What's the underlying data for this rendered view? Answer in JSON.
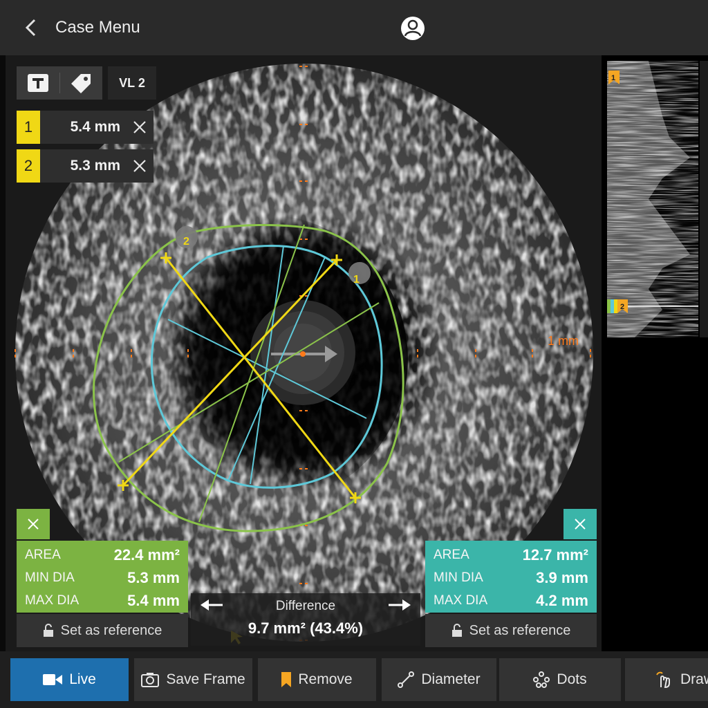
{
  "header": {
    "back_icon": "chevron-left-icon",
    "title": "Case Menu",
    "user_icon": "user-circle-icon"
  },
  "tools": {
    "text_tool_icon": "text-t-icon",
    "tag_tool_icon": "tag-icon",
    "vessel_label": "VL 2"
  },
  "measurements": [
    {
      "index": "1",
      "value": "5.4 mm"
    },
    {
      "index": "2",
      "value": "5.3 mm"
    }
  ],
  "scale_label": "1 mm",
  "frame_markers": [
    "1",
    "2"
  ],
  "left_panel": {
    "color": "#7cb342",
    "rows": [
      {
        "label": "AREA",
        "value": "22.4 mm²"
      },
      {
        "label": "MIN DIA",
        "value": "5.3 mm"
      },
      {
        "label": "MAX DIA",
        "value": "5.4 mm"
      }
    ],
    "reference_label": "Set as reference"
  },
  "right_panel": {
    "color": "#3bb5a9",
    "rows": [
      {
        "label": "AREA",
        "value": "12.7 mm²"
      },
      {
        "label": "MIN DIA",
        "value": "3.9 mm"
      },
      {
        "label": "MAX DIA",
        "value": "4.2 mm"
      }
    ],
    "reference_label": "Set as reference"
  },
  "difference": {
    "label": "Difference",
    "value": "9.7 mm²  (43.4%)"
  },
  "longitudinal_markers": [
    "1",
    "2"
  ],
  "toolbar": {
    "buttons": [
      {
        "label": "Live",
        "icon": "video-camera-icon"
      },
      {
        "label": "Save Frame",
        "icon": "camera-icon"
      },
      {
        "label": "Remove",
        "icon": "bookmark-icon"
      },
      {
        "label": "Diameter",
        "icon": "diameter-icon"
      },
      {
        "label": "Dots",
        "icon": "dots-icon"
      },
      {
        "label": "Draw",
        "icon": "draw-hand-icon"
      }
    ]
  },
  "colors": {
    "vessel_border": "#8bc34a",
    "lumen_border": "#5ec8d8",
    "diameter_lines": "#f0d815",
    "scale_marks": "#ff7a1a",
    "active_button": "#1e6fae"
  }
}
